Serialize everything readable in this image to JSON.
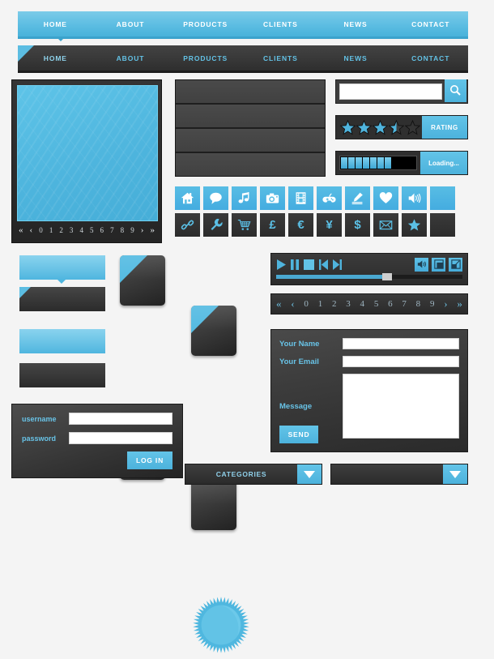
{
  "nav_light": {
    "items": [
      {
        "label": "HOME"
      },
      {
        "label": "ABOUT"
      },
      {
        "label": "PRODUCTS"
      },
      {
        "label": "CLIENTS"
      },
      {
        "label": "NEWS"
      },
      {
        "label": "CONTACT"
      }
    ]
  },
  "nav_dark": {
    "items": [
      {
        "label": "HOME"
      },
      {
        "label": "ABOUT"
      },
      {
        "label": "PRODUCTS"
      },
      {
        "label": "CLIENTS"
      },
      {
        "label": "NEWS"
      },
      {
        "label": "CONTACT"
      }
    ]
  },
  "gallery": {
    "pager": [
      "«",
      "‹",
      "0",
      "1",
      "2",
      "3",
      "4",
      "5",
      "6",
      "7",
      "8",
      "9",
      "›",
      "»"
    ]
  },
  "search": {
    "value": "",
    "placeholder": "",
    "icon": "search-icon"
  },
  "rating": {
    "label": "RATING",
    "value": 3.5,
    "max": 5
  },
  "loading": {
    "label": "Loading...",
    "filled_segments": 7,
    "total_segments": 12
  },
  "icons": {
    "row_blue": [
      "home-icon",
      "chat-bubble-icon",
      "music-note-icon",
      "camera-icon",
      "film-icon",
      "game-controller-icon",
      "pencil-icon",
      "heart-icon",
      "speaker-icon",
      "blank-icon"
    ],
    "row_dark": [
      "link-icon",
      "wrench-icon",
      "shopping-cart-icon",
      "pound-icon",
      "euro-icon",
      "yen-icon",
      "dollar-icon",
      "envelope-icon",
      "star-icon",
      "blank-icon"
    ],
    "currency_glyphs": {
      "pound": "£",
      "euro": "€",
      "yen": "¥",
      "dollar": "$"
    }
  },
  "player": {
    "buttons": [
      "play-button",
      "pause-button",
      "stop-button",
      "previous-button",
      "next-button"
    ],
    "right_buttons": [
      "volume-button",
      "window-button",
      "fullscreen-button"
    ],
    "progress_percent": 60
  },
  "pagination": {
    "items": [
      "«",
      "‹",
      "0",
      "1",
      "2",
      "3",
      "4",
      "5",
      "6",
      "7",
      "8",
      "9",
      "›",
      "»"
    ]
  },
  "contact_form": {
    "name_label": "Your Name",
    "name_value": "",
    "email_label": "Your Email",
    "email_value": "",
    "message_label": "Message",
    "message_value": "",
    "send_label": "SEND"
  },
  "login_form": {
    "username_label": "username",
    "username_value": "",
    "password_label": "password",
    "password_value": "",
    "submit_label": "LOG IN"
  },
  "dropdowns": [
    {
      "label": "CATEGORIES"
    },
    {
      "label": ""
    }
  ],
  "colors": {
    "accent_blue": "#5cbde2",
    "light_blue": "#7ccbe8",
    "dark_panel": "#2e2e2e",
    "dark_border": "#1c1c1c",
    "label_blue": "#68c3e7",
    "white": "#ffffff"
  }
}
